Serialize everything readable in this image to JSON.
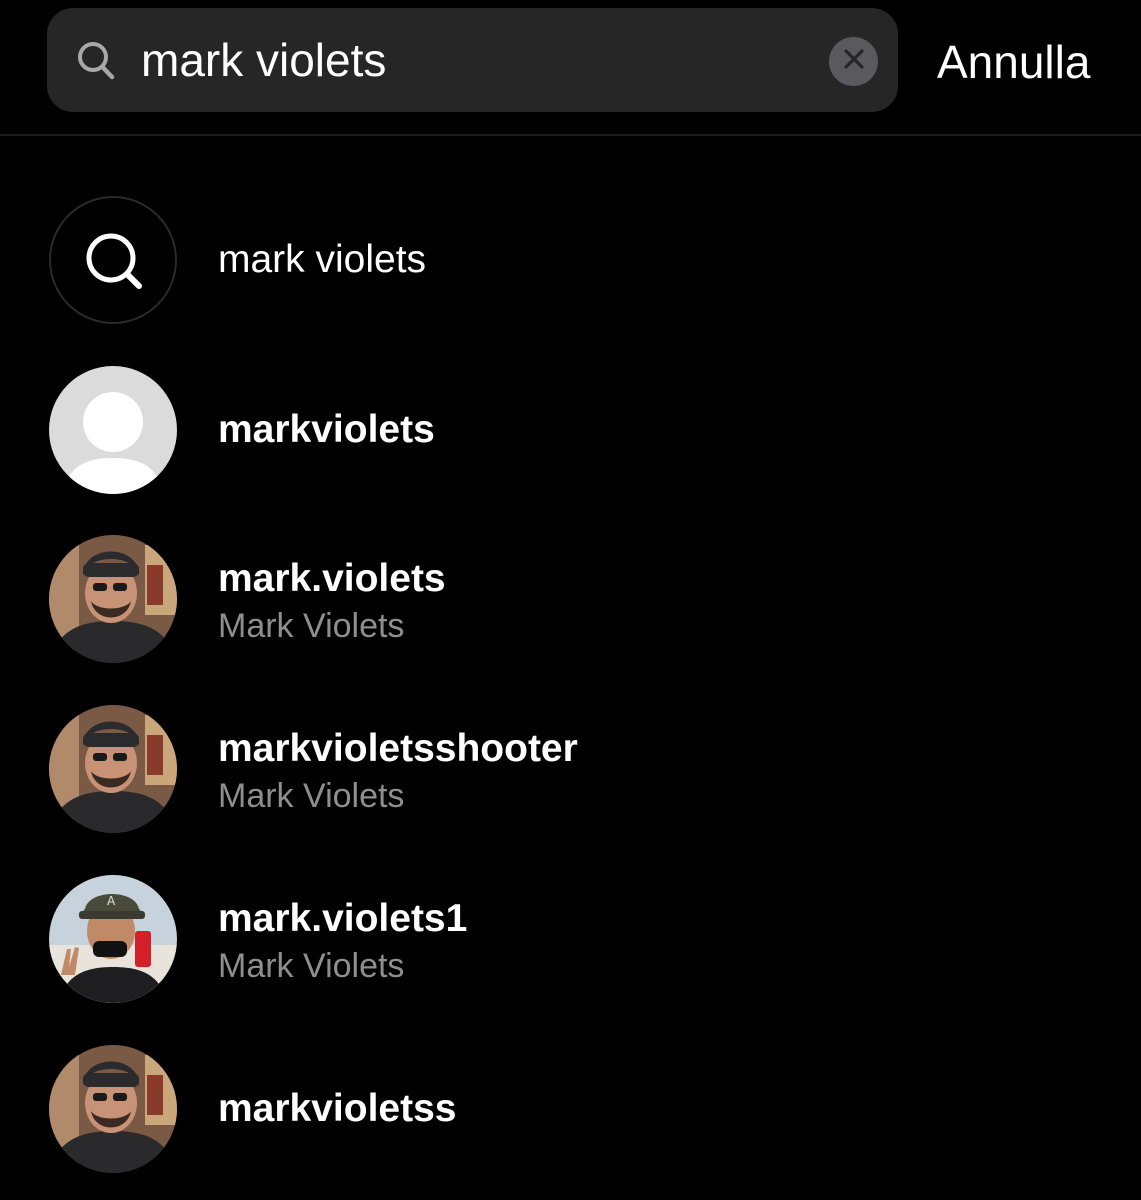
{
  "search": {
    "value": "mark violets",
    "cancel_label": "Annulla"
  },
  "results": [
    {
      "type": "query",
      "primary": "mark violets",
      "icon": "search-icon"
    },
    {
      "type": "user",
      "username": "markviolets",
      "avatar": "default-avatar-icon"
    },
    {
      "type": "user",
      "username": "mark.violets",
      "full_name": "Mark Violets",
      "avatar": "profile-photo"
    },
    {
      "type": "user",
      "username": "markvioletsshooter",
      "full_name": "Mark Violets",
      "avatar": "profile-photo"
    },
    {
      "type": "user",
      "username": "mark.violets1",
      "full_name": "Mark Violets",
      "avatar": "profile-photo"
    },
    {
      "type": "user",
      "username": "markvioletss",
      "avatar": "profile-photo"
    }
  ],
  "colors": {
    "background": "#000000",
    "search_field": "#262626",
    "secondary_text": "#8e8e8e"
  }
}
